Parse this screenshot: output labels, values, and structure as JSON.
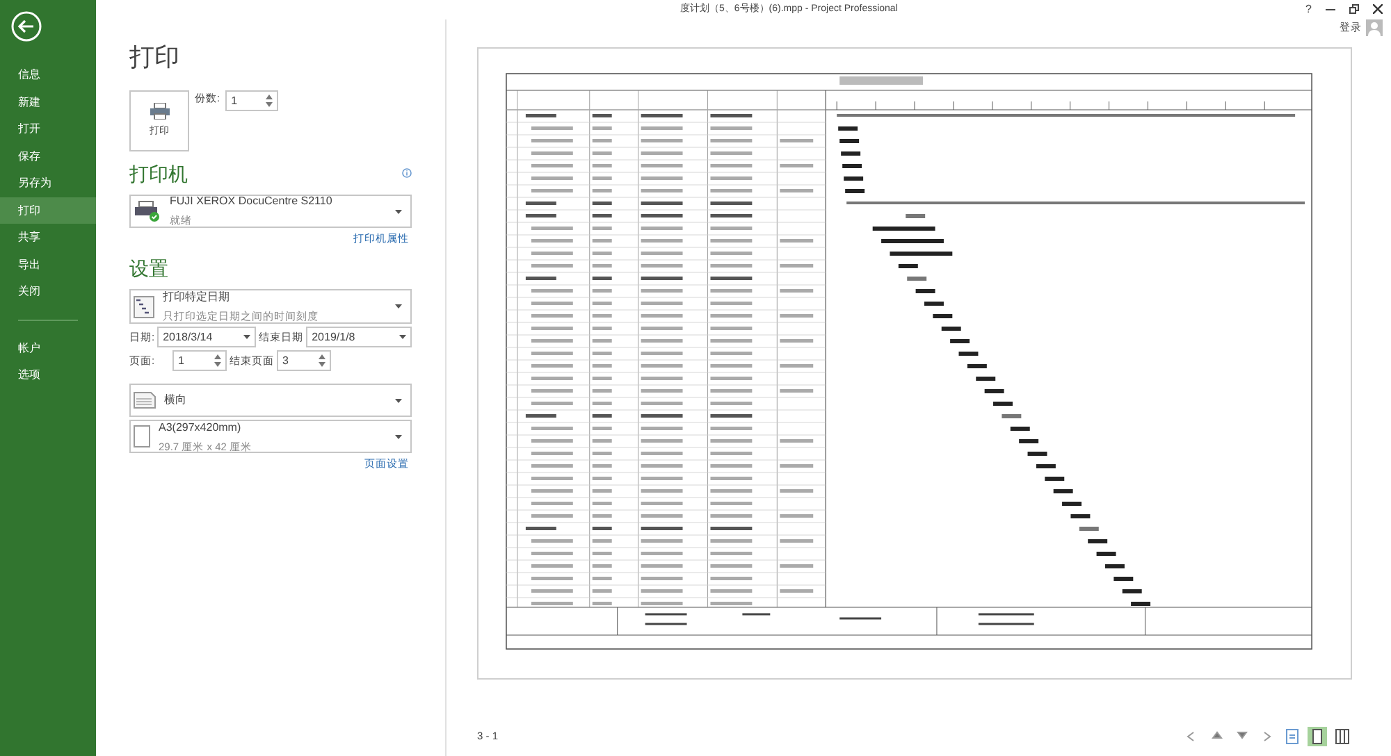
{
  "window": {
    "title": "度计划（5、6号楼）(6).mpp - Project Professional",
    "help": "?",
    "sign_in": "登录"
  },
  "sidebar": {
    "items": [
      {
        "label": "信息",
        "selected": false
      },
      {
        "label": "新建",
        "selected": false
      },
      {
        "label": "打开",
        "selected": false
      },
      {
        "label": "保存",
        "selected": false
      },
      {
        "label": "另存为",
        "selected": false
      },
      {
        "label": "打印",
        "selected": true
      },
      {
        "label": "共享",
        "selected": false
      },
      {
        "label": "导出",
        "selected": false
      },
      {
        "label": "关闭",
        "selected": false
      }
    ],
    "bottom_items": [
      {
        "label": "帐户",
        "selected": false
      },
      {
        "label": "选项",
        "selected": false
      }
    ]
  },
  "print": {
    "heading": "打印",
    "button": "打印",
    "copies_label": "份数:",
    "copies": "1"
  },
  "printer": {
    "heading": "打印机",
    "name": "FUJI XEROX DocuCentre S2110",
    "status": "就绪",
    "properties_link": "打印机属性"
  },
  "settings": {
    "heading": "设置",
    "range": {
      "title": "打印特定日期",
      "subtitle": "只打印选定日期之间的时间刻度"
    },
    "date_label": "日期:",
    "start_date": "2018/3/14",
    "end_date_label": "结束日期",
    "end_date": "2019/1/8",
    "page_label": "页面:",
    "start_page": "1",
    "end_page_label": "结束页面",
    "end_page": "3",
    "orientation": {
      "title": "横向"
    },
    "paper": {
      "title": "A3(297x420mm)",
      "subtitle": "29.7 厘米 x 42 厘米"
    },
    "page_setup_link": "页面设置"
  },
  "preview": {
    "page_indicator": "3 - 1",
    "views": [
      {
        "selected": false
      },
      {
        "selected": true
      },
      {
        "selected": false
      }
    ]
  }
}
